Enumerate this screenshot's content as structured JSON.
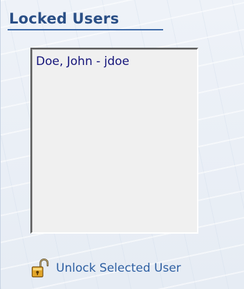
{
  "panel": {
    "title": "Locked Users"
  },
  "locked_users": [
    {
      "label": "Doe, John - jdoe"
    }
  ],
  "actions": {
    "unlock_label": "Unlock Selected User",
    "unlock_icon": "unlock-icon"
  },
  "colors": {
    "title": "#2a4f86",
    "list_text": "#14147a",
    "link": "#2e5fa2",
    "list_background": "#f0f0f0"
  }
}
